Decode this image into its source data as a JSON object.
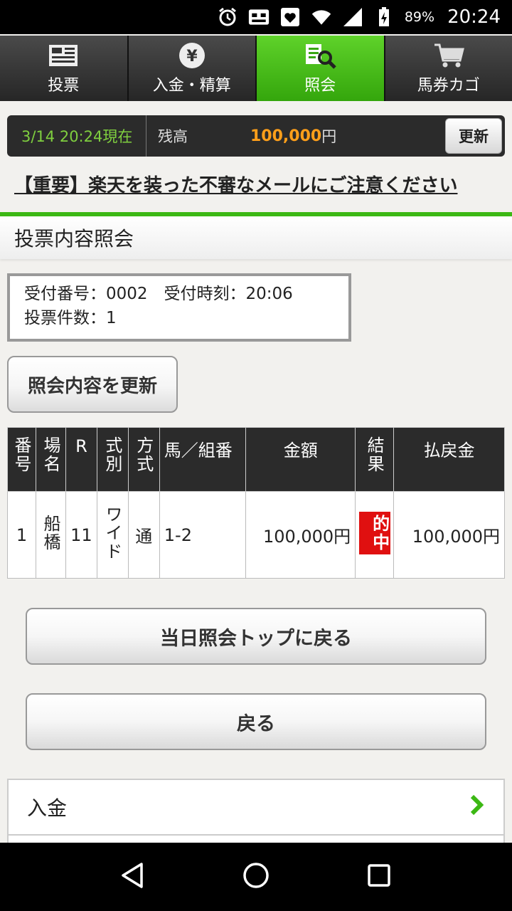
{
  "status_bar": {
    "battery_pct": "89%",
    "time": "20:24"
  },
  "tabs": [
    {
      "label": "投票",
      "icon": "ballot-icon"
    },
    {
      "label": "入金・精算",
      "icon": "yen-icon"
    },
    {
      "label": "照会",
      "icon": "inquiry-icon"
    },
    {
      "label": "馬券カゴ",
      "icon": "cart-icon"
    }
  ],
  "balance": {
    "datetime": "3/14 20:24現在",
    "label": "残高",
    "amount": "100,000",
    "unit": "円",
    "refresh_label": "更新"
  },
  "notice": "【重要】楽天を装った不審なメールにご注意ください",
  "section_title": "投票内容照会",
  "receipt": {
    "line1": "受付番号：0002　受付時刻：20:06",
    "line2": "投票件数：1"
  },
  "refresh_inquiry_label": "照会内容を更新",
  "table": {
    "headers": [
      "番号",
      "場名",
      "R",
      "式別",
      "方式",
      "馬／組番",
      "金額",
      "結果",
      "払戻金"
    ],
    "rows": [
      {
        "num": "1",
        "venue": "船橋",
        "race": "11",
        "type": "ワイド",
        "method": "通",
        "combo": "1-2",
        "amount": "100,000円",
        "result": "的中",
        "payout": "100,000円"
      }
    ]
  },
  "buttons": {
    "back_top": "当日照会トップに戻る",
    "back": "戻る"
  },
  "menu": [
    {
      "label": "入金"
    }
  ],
  "colors": {
    "accent_green": "#3cb814",
    "balance_orange": "#ff9f1a",
    "hit_red": "#e01010"
  }
}
